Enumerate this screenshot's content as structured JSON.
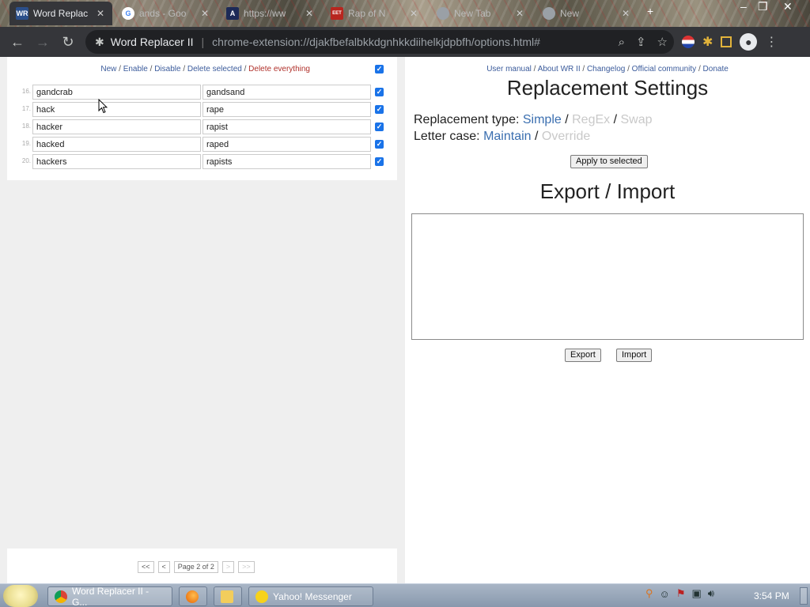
{
  "tabs": [
    {
      "title": "Word Replac",
      "favicon": "WR",
      "active": true
    },
    {
      "title": "ands - Goo",
      "favicon": "G"
    },
    {
      "title": "https://ww",
      "favicon": "A"
    },
    {
      "title": "Rap of N",
      "favicon": "EET"
    },
    {
      "title": "New Tab",
      "favicon": "chrome"
    },
    {
      "title": "New",
      "favicon": "chrome"
    }
  ],
  "toolbar": {
    "site_name": "Word Replacer II",
    "url": "chrome-extension://djakfbefalbkkdgnhkkdiihelkjdpbfh/options.html#"
  },
  "left": {
    "actions": {
      "new": "New",
      "enable": "Enable",
      "disable": "Disable",
      "delete_selected": "Delete selected",
      "delete_everything": "Delete everything",
      "sep": " / "
    },
    "rows": [
      {
        "num": "16.",
        "find": "gandcrab",
        "replace": "gandsand",
        "checked": true
      },
      {
        "num": "17.",
        "find": "hack",
        "replace": "rape",
        "checked": true
      },
      {
        "num": "18.",
        "find": "hacker",
        "replace": "rapist",
        "checked": true
      },
      {
        "num": "19.",
        "find": "hacked",
        "replace": "raped",
        "checked": true
      },
      {
        "num": "20.",
        "find": "hackers",
        "replace": "rapists",
        "checked": true
      }
    ],
    "pager": {
      "first": "<<",
      "prev": "<",
      "page": "Page 2 of 2",
      "next": ">",
      "last": ">>"
    }
  },
  "right": {
    "links": {
      "manual": "User manual",
      "about": "About WR II",
      "changelog": "Changelog",
      "community": "Official community",
      "donate": "Donate",
      "sep": " / "
    },
    "settings_title": "Replacement Settings",
    "replacement_type": {
      "label": "Replacement type:",
      "simple": "Simple",
      "regex": "RegEx",
      "swap": "Swap",
      "sep": " / "
    },
    "letter_case": {
      "label": "Letter case:",
      "maintain": "Maintain",
      "override": "Override",
      "sep": " / "
    },
    "apply_button": "Apply to selected",
    "export_title": "Export / Import",
    "export_button": "Export",
    "import_button": "Import"
  },
  "taskbar": {
    "tasks": [
      "Word Replacer II - G...",
      "Yahoo! Messenger"
    ],
    "clock": "3:54 PM"
  },
  "colors": {
    "link": "#3b5b9b",
    "danger": "#b0302a",
    "checkbox": "#1a73e8",
    "active_option": "#3b6fb0",
    "inactive_option": "#c9c9c9"
  }
}
